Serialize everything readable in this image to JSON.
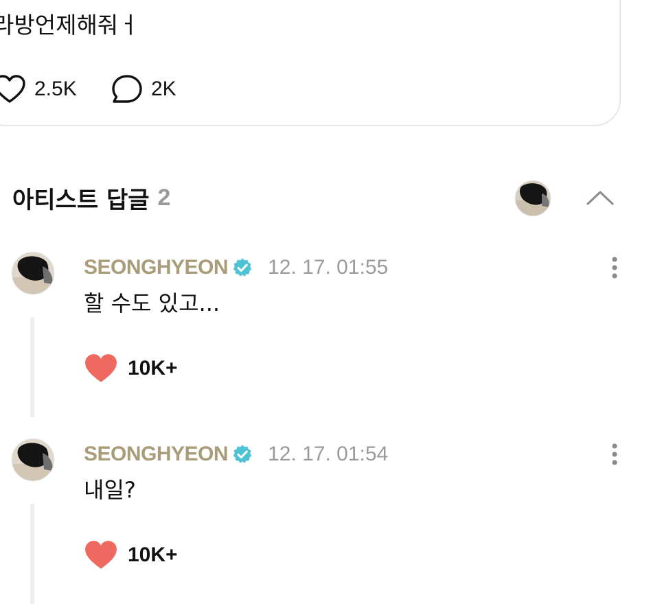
{
  "post": {
    "text": "라방언제해줘ㅓ",
    "likes": "2.5K",
    "comments": "2K"
  },
  "replies_section": {
    "title": "아티스트 답글",
    "count": "2"
  },
  "replies": [
    {
      "author": "SEONGHYEON",
      "time": "12. 17. 01:55",
      "text": "할 수도 있고...",
      "likes": "10K+"
    },
    {
      "author": "SEONGHYEON",
      "time": "12. 17. 01:54",
      "text": "내일?",
      "likes": "10K+"
    }
  ],
  "icons": {
    "like_outline": "heart-outline-icon",
    "comment": "speech-bubble-icon",
    "collapse": "chevron-up-icon",
    "more": "more-vertical-icon",
    "verified": "verified-badge-icon",
    "liked": "heart-filled-icon"
  },
  "colors": {
    "author": "#a89d78",
    "verified": "#4fc3d6",
    "liked_heart": "#ee6a60",
    "muted_text": "#9a9a9a"
  }
}
